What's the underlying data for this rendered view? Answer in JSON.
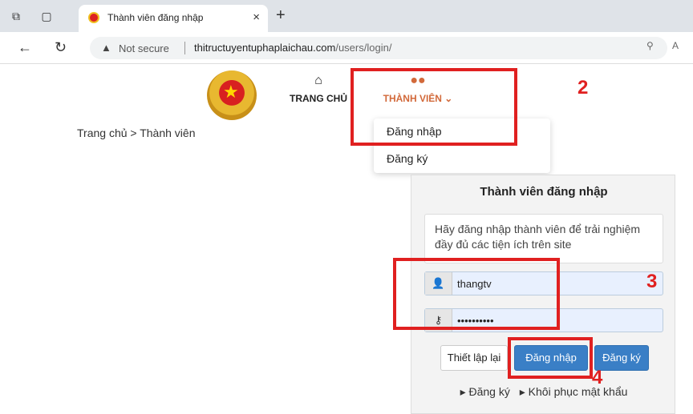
{
  "browser": {
    "tab_title": "Thành viên đăng nhập",
    "tab_close": "×",
    "new_tab": "+",
    "not_secure": "Not secure",
    "url_domain": "thitructuyentuphaplaichau.com",
    "url_path": "/users/login/"
  },
  "nav": {
    "home_label": "TRANG CHỦ",
    "member_label": "THÀNH VIÊN ⌄"
  },
  "breadcrumb": "Trang chủ  >  Thành viên",
  "dropdown": {
    "items": [
      "Đăng nhập",
      "Đăng ký"
    ]
  },
  "login_panel": {
    "title": "Thành viên đăng nhập",
    "info": "Hãy đăng nhập thành viên để trải nghiệm đầy đủ các tiện ích trên site",
    "username_value": "thangtv",
    "password_value": "••••••••••",
    "reset_label": "Thiết lập lại",
    "login_label": "Đăng nhập",
    "register_label": "Đăng ký",
    "link_register": "▸ Đăng ký",
    "link_recover": "▸ Khôi phục mật khẩu"
  },
  "annotations": {
    "step2": "2",
    "step3": "3",
    "step4": "4",
    "color": "#e02020"
  }
}
